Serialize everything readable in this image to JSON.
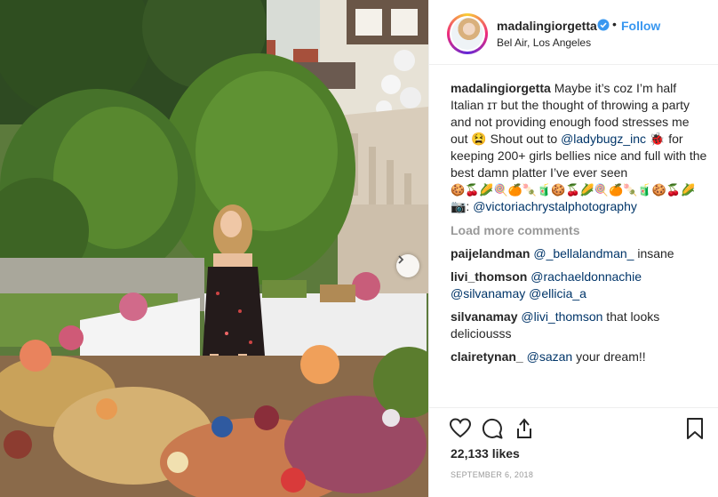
{
  "post": {
    "username": "madalingiorgetta",
    "verified": true,
    "follow_label": "Follow",
    "separator": "•",
    "location": "Bel Air, Los Angeles",
    "caption": {
      "username": "madalingiorgetta",
      "text1": "Maybe it’s coz I’m half Italian ɪᴛ but the thought of throwing a party and not providing enough food stresses me out 😫 Shout out to ",
      "mention1": "@ladybugz_inc",
      "text2": " 🐞 for keeping 200+ girls bellies nice and full with the best damn platter I’ve ever seen",
      "emojis": "🍪🍒🌽🍭🍊🍡🧃🍪🍒🌽🍭🍊🍡🧃🍪🍒🌽",
      "camera": "📷:",
      "mention2": "@victoriachrystalphotography"
    },
    "load_more_label": "Load more comments",
    "comments": [
      {
        "username": "paijelandman",
        "mentions": [
          "@_bellalandman_"
        ],
        "text": " insane"
      },
      {
        "username": "livi_thomson",
        "mentions": [
          "@rachaeldonnachie",
          "@silvanamay",
          "@ellicia_a"
        ],
        "text": ""
      },
      {
        "username": "silvanamay",
        "mentions": [
          "@livi_thomson"
        ],
        "text": " that looks deliciousss"
      },
      {
        "username": "clairetynan_",
        "mentions": [
          "@sazan"
        ],
        "text": " your dream!!"
      }
    ],
    "likes": "22,133 likes",
    "date": "SEPTEMBER 6, 2018"
  },
  "icons": {
    "like": "heart-icon",
    "comment": "comment-icon",
    "share": "share-icon",
    "save": "bookmark-icon",
    "next": "chevron-right-icon",
    "verified": "verified-badge-icon"
  },
  "colors": {
    "link": "#003569",
    "follow": "#3897f0",
    "muted": "#999999",
    "verified": "#3897f0"
  }
}
